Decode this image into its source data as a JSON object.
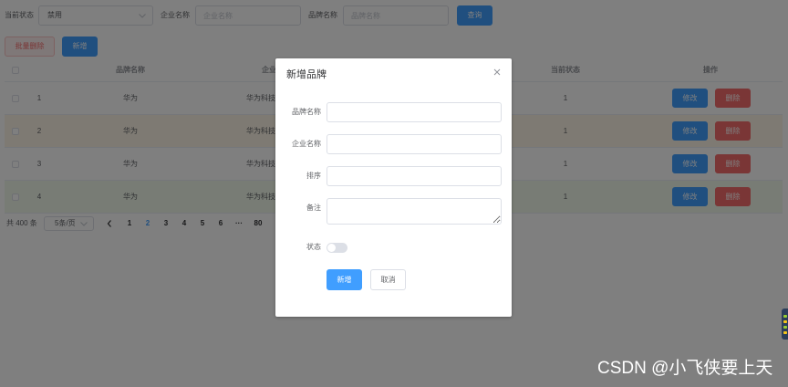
{
  "filters": {
    "status_label": "当前状态",
    "status_value": "禁用",
    "company_label": "企业名称",
    "company_placeholder": "企业名称",
    "brand_label": "品牌名称",
    "brand_placeholder": "品牌名称",
    "search_button": "查询"
  },
  "toolbar": {
    "batch_delete_button": "批量删除",
    "add_button": "新增"
  },
  "table": {
    "headers": {
      "brand_name": "品牌名称",
      "company_name": "企业",
      "status": "当前状态",
      "operations": "操作"
    },
    "actions": {
      "edit": "修改",
      "delete": "删除"
    },
    "rows": [
      {
        "index": "1",
        "brand_name": "华为",
        "company_name": "华为科技",
        "status": "1",
        "bg": "#ffffff"
      },
      {
        "index": "2",
        "brand_name": "华为",
        "company_name": "华为科技",
        "status": "1",
        "bg": "#fdf5e6"
      },
      {
        "index": "3",
        "brand_name": "华为",
        "company_name": "华为科技",
        "status": "1",
        "bg": "#ffffff"
      },
      {
        "index": "4",
        "brand_name": "华为",
        "company_name": "华为科技",
        "status": "1",
        "bg": "#f0f9eb"
      }
    ]
  },
  "pagination": {
    "total": "共 400 条",
    "page_size": "5条/页",
    "pages": [
      {
        "label": "1",
        "active": false
      },
      {
        "label": "2",
        "active": true
      },
      {
        "label": "3",
        "active": false
      },
      {
        "label": "4",
        "active": false
      },
      {
        "label": "5",
        "active": false
      },
      {
        "label": "6",
        "active": false
      },
      {
        "label": "···",
        "active": false
      },
      {
        "label": "80",
        "active": false
      }
    ]
  },
  "dialog": {
    "title": "新增品牌",
    "labels": {
      "brand_name": "品牌名称",
      "company_name": "企业名称",
      "order": "排序",
      "remark": "备注",
      "status": "状态"
    },
    "values": {
      "brand_name": "",
      "company_name": "",
      "order": "",
      "remark": ""
    },
    "status_on": false,
    "submit_button": "新增",
    "cancel_button": "取消"
  },
  "watermark": "CSDN @小飞侠要上天",
  "icons": {
    "select_arrow": "chevron-down-icon",
    "prev_page": "chevron-left-icon",
    "dialog_close": "close-icon"
  },
  "colors": {
    "primary": "#409eff",
    "danger": "#f56c6c",
    "mask": "rgba(0, 0, 0, 0.5)"
  }
}
